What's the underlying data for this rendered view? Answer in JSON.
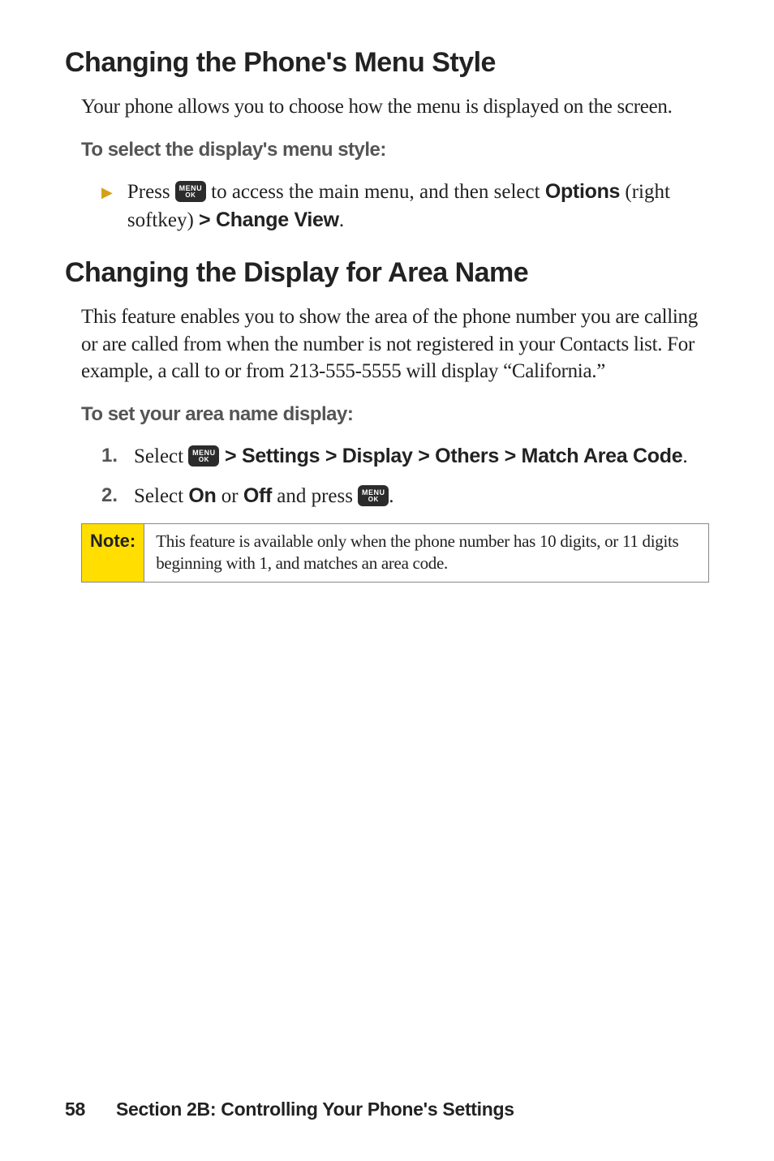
{
  "section1": {
    "heading": "Changing the Phone's Menu Style",
    "intro": "Your phone allows you to choose how the menu is displayed on the screen.",
    "subheading": "To select the display's menu style:",
    "bullet": {
      "text_before": "Press ",
      "text_mid": " to access the main menu, and then select ",
      "options_label": "Options",
      "softkey_text": " (right softkey) ",
      "change_view": "> Change View",
      "period": "."
    }
  },
  "section2": {
    "heading": "Changing the Display for Area Name",
    "intro": "This feature enables you to show the area of the phone number you are calling or are called from when the number is not registered in your Contacts list. For example, a call to or from 213-555-5555 will display “California.”",
    "subheading": "To set your area name display:",
    "step1": {
      "num": "1.",
      "prefix": "Select ",
      "path": " > Settings > Display > Others > Match Area Code",
      "period": "."
    },
    "step2": {
      "num": "2.",
      "prefix": "Select ",
      "on": "On",
      "or": " or ",
      "off": "Off",
      "and_press": " and press ",
      "period": "."
    }
  },
  "note": {
    "label": "Note:",
    "content": "This feature is available only when the phone number has 10 digits, or 11 digits beginning with 1, and matches an area code."
  },
  "footer": {
    "page": "58",
    "text": "Section 2B: Controlling Your Phone's Settings"
  },
  "icon": {
    "menu": "MENU",
    "ok": "OK"
  }
}
